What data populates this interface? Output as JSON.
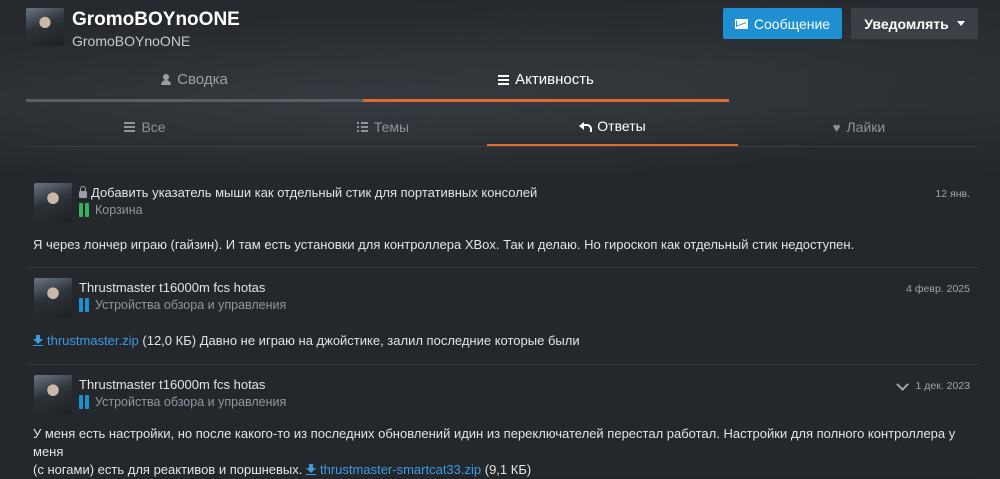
{
  "profile": {
    "name": "GromoBOYnoONE",
    "username": "GromoBOYnoONE"
  },
  "actions": {
    "message_label": "Сообщение",
    "notify_label": "Уведомлять"
  },
  "top_tabs": [
    {
      "label": "Сводка",
      "icon": "user-icon",
      "active": false
    },
    {
      "label": "Активность",
      "icon": "bars-icon",
      "active": true
    }
  ],
  "sub_tabs": [
    {
      "label": "Все",
      "icon": "bars-icon",
      "active": false
    },
    {
      "label": "Темы",
      "icon": "list-icon",
      "active": false
    },
    {
      "label": "Ответы",
      "icon": "reply-icon",
      "active": true
    },
    {
      "label": "Лайки",
      "icon": "heart-icon",
      "active": false
    }
  ],
  "items": [
    {
      "title": "Добавить указатель мыши как отдельный стик для портативных консолей",
      "locked": true,
      "forum": "Корзина",
      "forum_icon": "green",
      "date": "12 янв.",
      "body": "Я через лончер играю (гайзин). И там есть установки для контроллера XBox. Так и делаю. Но гироскоп как отдельный стик недоступен."
    },
    {
      "title": "Thrustmaster t16000m fcs hotas",
      "locked": false,
      "forum": "Устройства обзора и управления",
      "forum_icon": "blue",
      "date": "4 февр. 2025",
      "attachment": "thrustmaster.zip",
      "attachment_size": "(12,0 КБ)",
      "body": "Давно не играю на джойстике, залил последние которые были"
    },
    {
      "title": "Thrustmaster t16000m fcs hotas",
      "locked": false,
      "forum": "Устройства обзора и управления",
      "forum_icon": "blue",
      "date": "1 дек. 2023",
      "body_line1": "У меня есть настройки, но после какого-то из последних обновлений идин из переключателей перестал работал. Настройки для полного контроллера у меня",
      "body_line2": "(с ногами) есть для реактивов и поршневых.",
      "attachment": "thrustmaster-smartcat33.zip",
      "attachment_size": "(9,1 КБ)"
    }
  ],
  "colors": {
    "accent": "#e06a2f",
    "primary_button": "#1e8fd0",
    "link": "#3d9be0",
    "forum_green": "#36b35a",
    "forum_blue": "#1e8fd0"
  }
}
